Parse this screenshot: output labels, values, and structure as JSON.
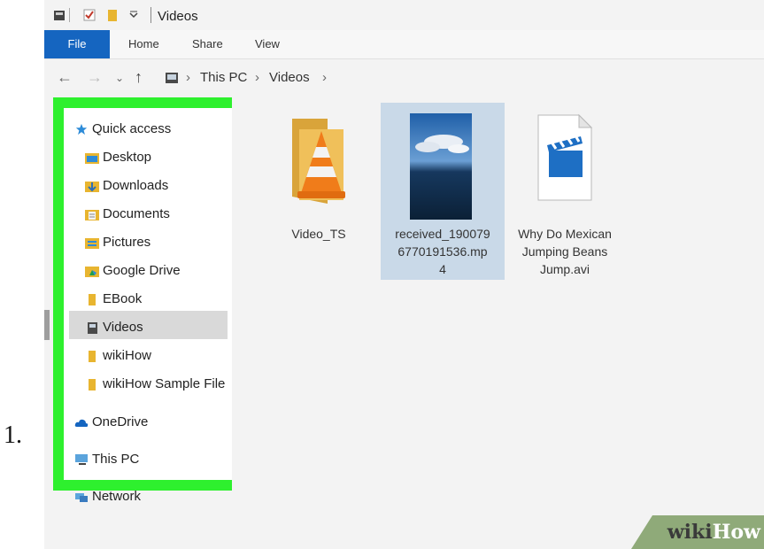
{
  "step_number": "1.",
  "window": {
    "title": "Videos"
  },
  "ribbon": {
    "tabs": [
      "File",
      "Home",
      "Share",
      "View"
    ]
  },
  "address": {
    "breadcrumb": [
      "This PC",
      "Videos"
    ]
  },
  "nav_pane": {
    "quick_access": "Quick access",
    "items": [
      {
        "label": "Desktop",
        "icon": "desktop-folder-icon",
        "pinned": true
      },
      {
        "label": "Downloads",
        "icon": "downloads-folder-icon",
        "pinned": true
      },
      {
        "label": "Documents",
        "icon": "documents-folder-icon",
        "pinned": true
      },
      {
        "label": "Pictures",
        "icon": "pictures-folder-icon",
        "pinned": true
      },
      {
        "label": "Google Drive",
        "icon": "google-drive-icon",
        "pinned": true
      },
      {
        "label": "EBook",
        "icon": "folder-icon",
        "pinned": false
      },
      {
        "label": "Videos",
        "icon": "videos-folder-icon",
        "pinned": false,
        "selected": true
      },
      {
        "label": "wikiHow",
        "icon": "folder-icon",
        "pinned": false
      },
      {
        "label": "wikiHow Sample File",
        "icon": "folder-icon",
        "pinned": false
      }
    ],
    "onedrive": "OneDrive",
    "this_pc": "This PC",
    "network": "Network"
  },
  "files": [
    {
      "name_lines": [
        "Video_TS"
      ],
      "type": "vlc-folder"
    },
    {
      "name_lines": [
        "received_190079",
        "6770191536.mp",
        "4"
      ],
      "type": "video-thumbnail",
      "selected": true
    },
    {
      "name_lines": [
        "Why Do Mexican",
        "Jumping Beans",
        "Jump.avi"
      ],
      "type": "avi-file"
    }
  ],
  "watermark": {
    "part1": "wiki",
    "part2": "How"
  },
  "colors": {
    "file_tab": "#1565c0",
    "highlight_box": "#2ef02e",
    "selection": "#c9d9e8"
  }
}
